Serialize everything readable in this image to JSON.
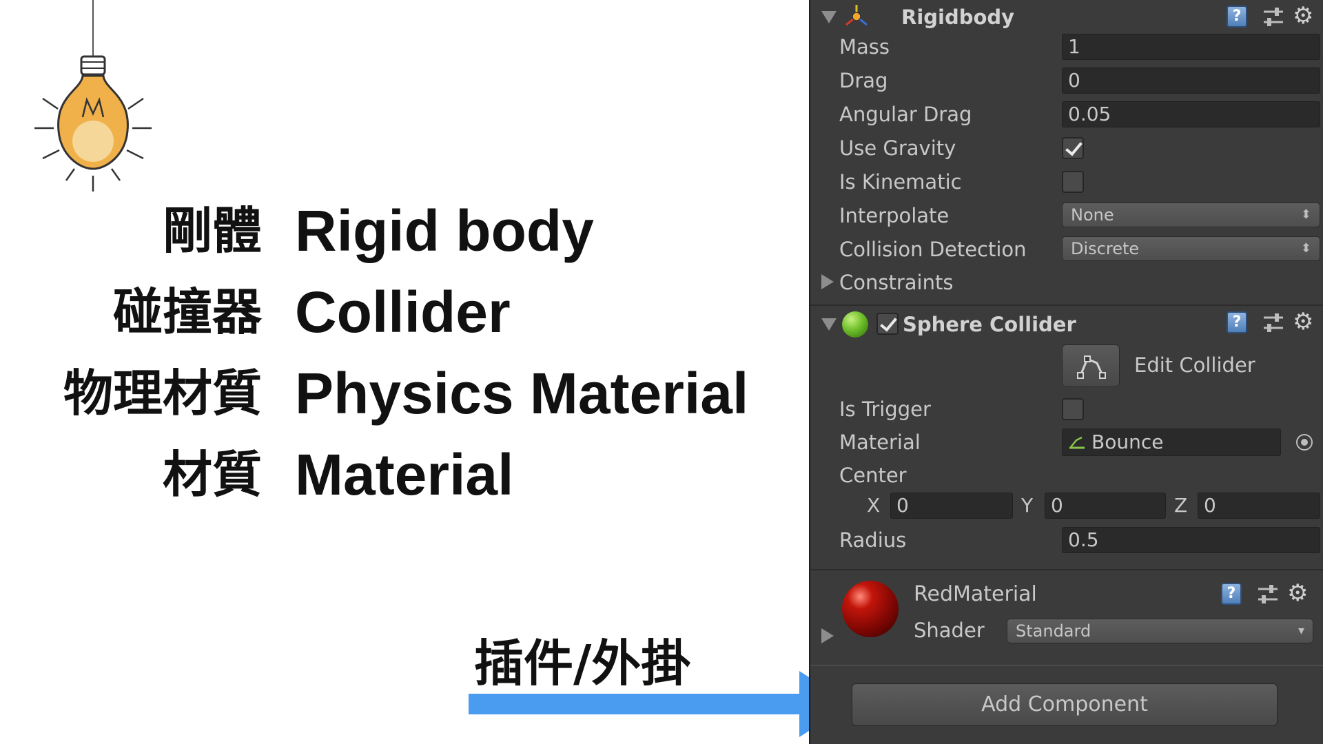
{
  "slide": {
    "terms": [
      {
        "zh": "剛體",
        "en": "Rigid body"
      },
      {
        "zh": "碰撞器",
        "en": "Collider"
      },
      {
        "zh": "物理材質",
        "en": "Physics Material"
      },
      {
        "zh": "材質",
        "en": "Material"
      }
    ],
    "plugin_label": "插件/外掛",
    "arrow_color": "#4a9cf0"
  },
  "inspector": {
    "rigidbody": {
      "title": "Rigidbody",
      "help_icon": "?",
      "mass_label": "Mass",
      "mass_value": "1",
      "drag_label": "Drag",
      "drag_value": "0",
      "angular_drag_label": "Angular Drag",
      "angular_drag_value": "0.05",
      "use_gravity_label": "Use Gravity",
      "use_gravity_checked": true,
      "is_kinematic_label": "Is Kinematic",
      "is_kinematic_checked": false,
      "interpolate_label": "Interpolate",
      "interpolate_value": "None",
      "collision_detection_label": "Collision Detection",
      "collision_detection_value": "Discrete",
      "constraints_label": "Constraints"
    },
    "sphere_collider": {
      "title": "Sphere Collider",
      "enabled": true,
      "help_icon": "?",
      "edit_collider_label": "Edit Collider",
      "is_trigger_label": "Is Trigger",
      "is_trigger_checked": false,
      "material_label": "Material",
      "material_value": "Bounce",
      "center_label": "Center",
      "center": [
        {
          "axis": "X",
          "value": "0"
        },
        {
          "axis": "Y",
          "value": "0"
        },
        {
          "axis": "Z",
          "value": "0"
        }
      ],
      "radius_label": "Radius",
      "radius_value": "0.5"
    },
    "material": {
      "name": "RedMaterial",
      "help_icon": "?",
      "shader_label": "Shader",
      "shader_value": "Standard"
    },
    "add_component_label": "Add Component",
    "dropdown_caret": "⬍",
    "shader_caret": "▾",
    "gear_glyph": "⚙",
    "colors": {
      "panel_bg": "#3b3b3b",
      "field_bg": "#2a2a2a",
      "text": "#c8c8c8",
      "sphere_icon_green": "#6fbf2a",
      "material_red": "#c2150a"
    }
  }
}
